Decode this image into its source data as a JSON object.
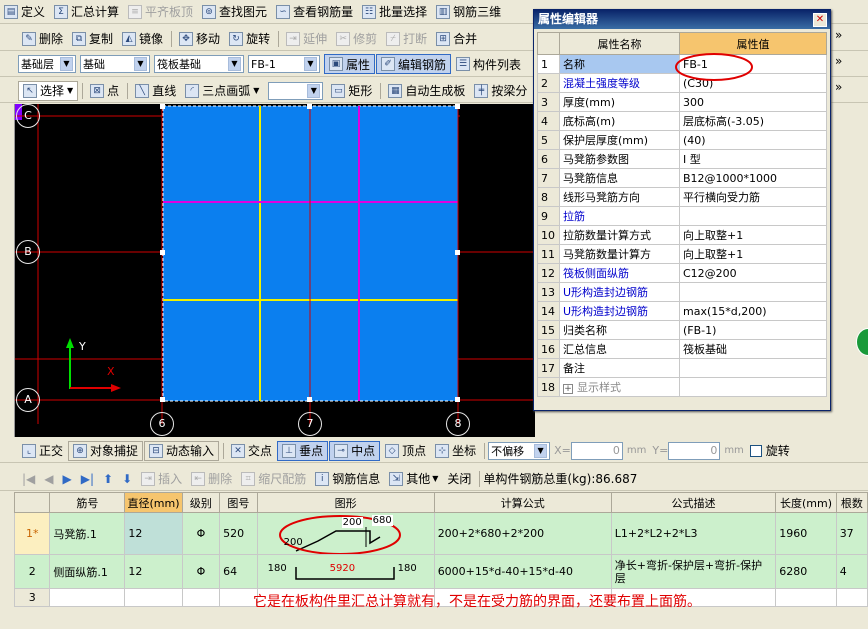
{
  "toolbar1": {
    "items": [
      "定义",
      "汇总计算",
      "平齐板顶",
      "查找图元",
      "查看钢筋量",
      "批量选择",
      "钢筋三维"
    ]
  },
  "toolbar2": {
    "items": [
      "删除",
      "复制",
      "镜像",
      "移动",
      "旋转",
      "延伸",
      "修剪",
      "打断",
      "合并"
    ]
  },
  "toolbar3": {
    "floor": "基础层",
    "type": "基础",
    "subtype": "筏板基础",
    "element": "FB-1",
    "attr": "属性",
    "edit_rebar": "编辑钢筋",
    "comp_list": "构件列表"
  },
  "toolbar4": {
    "select": "选择",
    "point": "点",
    "line": "直线",
    "arc": "三点画弧",
    "rect": "矩形",
    "auto": "自动生成板",
    "beam": "按梁分"
  },
  "axes": {
    "rows": [
      "C",
      "B",
      "A"
    ],
    "cols": [
      "6",
      "7",
      "8"
    ],
    "y_label": "Y",
    "x_label": "X"
  },
  "snapbar": {
    "ortho": "正交",
    "snap": "对象捕捉",
    "dyn": "动态输入",
    "inter": "交点",
    "perp": "垂点",
    "mid": "中点",
    "vertex": "顶点",
    "coord": "坐标",
    "offset": "不偏移",
    "x_label": "X=",
    "x_val": "0",
    "x_unit": "mm",
    "y_label": "Y=",
    "y_val": "0",
    "y_unit": "mm",
    "rotate": "旋转"
  },
  "rebarbar": {
    "insert": "插入",
    "delete": "删除",
    "scale": "缩尺配筋",
    "info": "钢筋信息",
    "other": "其他",
    "close": "关闭",
    "total_label": "单构件钢筋总重(kg):",
    "total": "86.687"
  },
  "prop_editor": {
    "title": "属性编辑器",
    "col_name": "属性名称",
    "col_value": "属性值",
    "rows": [
      {
        "n": "1",
        "name": "名称",
        "value": "FB-1",
        "blue": false
      },
      {
        "n": "2",
        "name": "混凝土强度等级",
        "value": "(C30)",
        "blue": true
      },
      {
        "n": "3",
        "name": "厚度(mm)",
        "value": "300",
        "blue": false
      },
      {
        "n": "4",
        "name": "底标高(m)",
        "value": "层底标高(-3.05)",
        "blue": false
      },
      {
        "n": "5",
        "name": "保护层厚度(mm)",
        "value": "(40)",
        "blue": false
      },
      {
        "n": "6",
        "name": "马凳筋参数图",
        "value": "I 型",
        "blue": false
      },
      {
        "n": "7",
        "name": "马凳筋信息",
        "value": "B12@1000*1000",
        "blue": false
      },
      {
        "n": "8",
        "name": "线形马凳筋方向",
        "value": "平行横向受力筋",
        "blue": false
      },
      {
        "n": "9",
        "name": "拉筋",
        "value": "",
        "blue": true
      },
      {
        "n": "10",
        "name": "拉筋数量计算方式",
        "value": "向上取整+1",
        "blue": false
      },
      {
        "n": "11",
        "name": "马凳筋数量计算方",
        "value": "向上取整+1",
        "blue": false
      },
      {
        "n": "12",
        "name": "筏板侧面纵筋",
        "value": "C12@200",
        "blue": true
      },
      {
        "n": "13",
        "name": "U形构造封边钢筋",
        "value": "",
        "blue": true
      },
      {
        "n": "14",
        "name": "U形构造封边钢筋",
        "value": "max(15*d,200)",
        "blue": true
      },
      {
        "n": "15",
        "name": "归类名称",
        "value": "(FB-1)",
        "blue": false
      },
      {
        "n": "16",
        "name": "汇总信息",
        "value": "筏板基础",
        "blue": false
      },
      {
        "n": "17",
        "name": "备注",
        "value": "",
        "blue": false
      },
      {
        "n": "18",
        "name": "显示样式",
        "value": "",
        "blue": false
      }
    ]
  },
  "grid": {
    "headers": [
      "筋号",
      "直径(mm)",
      "级别",
      "图号",
      "图形",
      "计算公式",
      "公式描述",
      "长度(mm)",
      "根数"
    ],
    "rows": [
      {
        "rn": "1*",
        "name": "马凳筋.1",
        "dia": "12",
        "grade": "Φ",
        "fig": "520",
        "shape": {
          "a": "200",
          "b": "680",
          "c": "200"
        },
        "formula": "200+2*680+2*200",
        "desc": "L1+2*L2+2*L3",
        "len": "1960",
        "count": "37"
      },
      {
        "rn": "2",
        "name": "侧面纵筋.1",
        "dia": "12",
        "grade": "Φ",
        "fig": "64",
        "shape": {
          "l": "180",
          "m": "5920",
          "r": "180"
        },
        "formula": "6000+15*d-40+15*d-40",
        "desc": "净长+弯折-保护层+弯折-保护层",
        "len": "6280",
        "count": "4"
      },
      {
        "rn": "3",
        "name": "",
        "dia": "",
        "grade": "",
        "fig": "",
        "formula": "",
        "desc": "",
        "len": "",
        "count": ""
      }
    ]
  },
  "note": "它是在板构件里汇总计算就有，不是在受力筋的界面，还要布置上面筋。"
}
